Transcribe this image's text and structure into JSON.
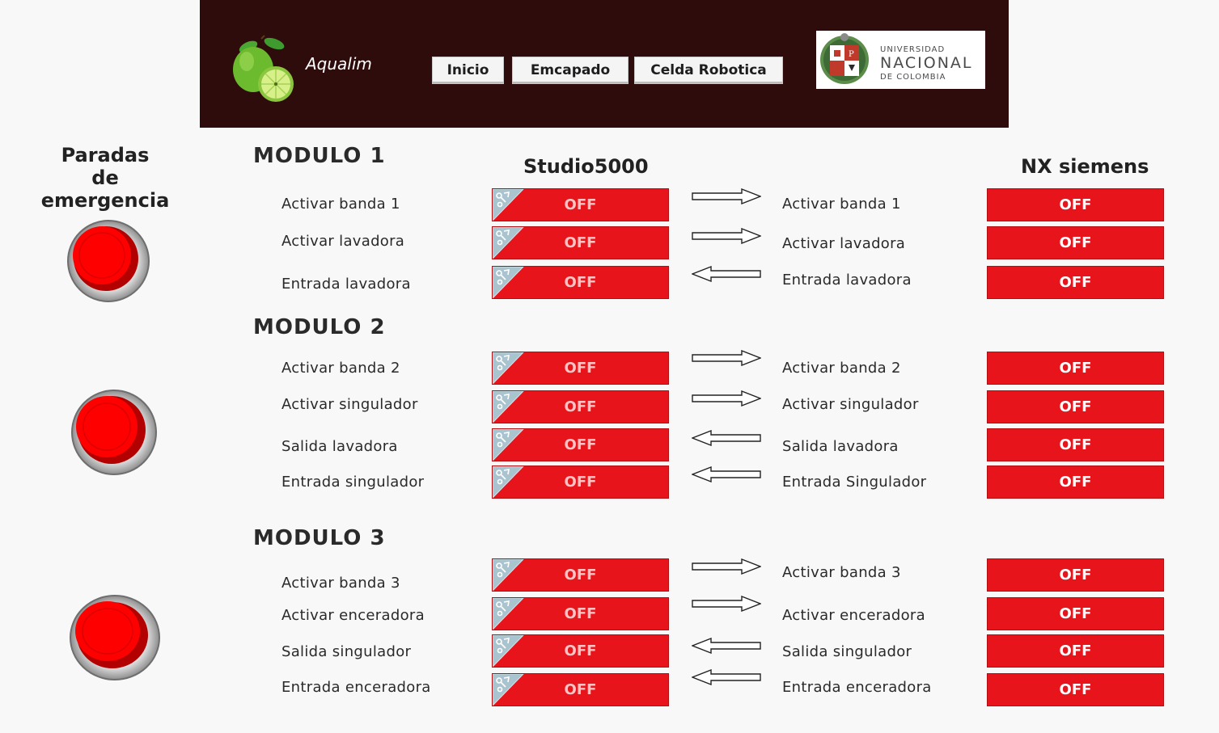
{
  "header": {
    "app_name": "Aqualim",
    "nav": [
      "Inicio",
      "Emcapado",
      "Celda Robotica"
    ],
    "university": {
      "line1": "UNIVERSIDAD",
      "line2": "NACIONAL",
      "line3": "DE COLOMBIA"
    }
  },
  "emergency": {
    "title_line1": "Paradas",
    "title_line2": "de emergencia"
  },
  "columns": {
    "studio": "Studio5000",
    "nx": "NX siemens"
  },
  "modules": [
    {
      "title": "MODULO  1",
      "rows": [
        {
          "left_label": "Activar banda 1",
          "studio_state": "OFF",
          "direction": "right",
          "right_label": "Activar banda 1",
          "nx_state": "OFF"
        },
        {
          "left_label": "Activar lavadora",
          "studio_state": "OFF",
          "direction": "right",
          "right_label": "Activar lavadora",
          "nx_state": "OFF"
        },
        {
          "left_label": "Entrada lavadora",
          "studio_state": "OFF",
          "direction": "left",
          "right_label": "Entrada lavadora",
          "nx_state": "OFF"
        }
      ]
    },
    {
      "title": "MODULO  2",
      "rows": [
        {
          "left_label": "Activar banda 2",
          "studio_state": "OFF",
          "direction": "right",
          "right_label": "Activar banda 2",
          "nx_state": "OFF"
        },
        {
          "left_label": "Activar singulador",
          "studio_state": "OFF",
          "direction": "right",
          "right_label": "Activar singulador",
          "nx_state": "OFF"
        },
        {
          "left_label": "Salida lavadora",
          "studio_state": "OFF",
          "direction": "left",
          "right_label": "Salida lavadora",
          "nx_state": "OFF"
        },
        {
          "left_label": "Entrada singulador",
          "studio_state": "OFF",
          "direction": "left",
          "right_label": "Entrada Singulador",
          "nx_state": "OFF"
        }
      ]
    },
    {
      "title": "MODULO  3",
      "rows": [
        {
          "left_label": "Activar banda 3",
          "studio_state": "OFF",
          "direction": "right",
          "right_label": "Activar banda 3",
          "nx_state": "OFF"
        },
        {
          "left_label": "Activar enceradora",
          "studio_state": "OFF",
          "direction": "right",
          "right_label": "Activar enceradora",
          "nx_state": "OFF"
        },
        {
          "left_label": "Salida singulador",
          "studio_state": "OFF",
          "direction": "left",
          "right_label": "Salida singulador",
          "nx_state": "OFF"
        },
        {
          "left_label": "Entrada enceradora",
          "studio_state": "OFF",
          "direction": "left",
          "right_label": "Entrada enceradora",
          "nx_state": "OFF"
        }
      ]
    }
  ],
  "colors": {
    "header_bg": "#2e0c0c",
    "off_red": "#e8141b",
    "estop_red": "#ff0000"
  }
}
